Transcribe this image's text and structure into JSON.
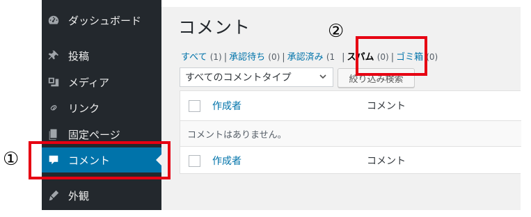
{
  "sidebar": {
    "items": [
      {
        "label": "ダッシュボード",
        "icon": "dashboard-icon"
      },
      {
        "label": "投稿",
        "icon": "pushpin-icon"
      },
      {
        "label": "メディア",
        "icon": "media-icon"
      },
      {
        "label": "リンク",
        "icon": "link-icon"
      },
      {
        "label": "固定ページ",
        "icon": "page-icon"
      },
      {
        "label": "コメント",
        "icon": "comment-icon",
        "current": true
      },
      {
        "label": "外観",
        "icon": "appearance-icon"
      }
    ]
  },
  "page": {
    "title": "コメント"
  },
  "filters": {
    "all": {
      "label": "すべて",
      "count": "(1)"
    },
    "pending": {
      "label": "承認待ち",
      "count": "(0)"
    },
    "approved": {
      "label": "承認済み",
      "count": "(1"
    },
    "spam": {
      "label": "スパム",
      "count": "(0)"
    },
    "trash": {
      "label": "ゴミ箱",
      "count": "(0)"
    },
    "separator": "|"
  },
  "comment_type_select": {
    "selected": "すべてのコメントタイプ"
  },
  "filter_button": {
    "label": "絞り込み検索"
  },
  "table": {
    "columns": {
      "author": "作成者",
      "comment": "コメント"
    },
    "empty_message": "コメントはありません。"
  },
  "annotations": {
    "marker_1": "①",
    "marker_2": "②",
    "highlight_color": "#e60012"
  },
  "colors": {
    "sidebar_bg": "#23282d",
    "current_item_bg": "#0073aa",
    "link": "#0073aa",
    "content_bg": "#f1f1f1"
  }
}
